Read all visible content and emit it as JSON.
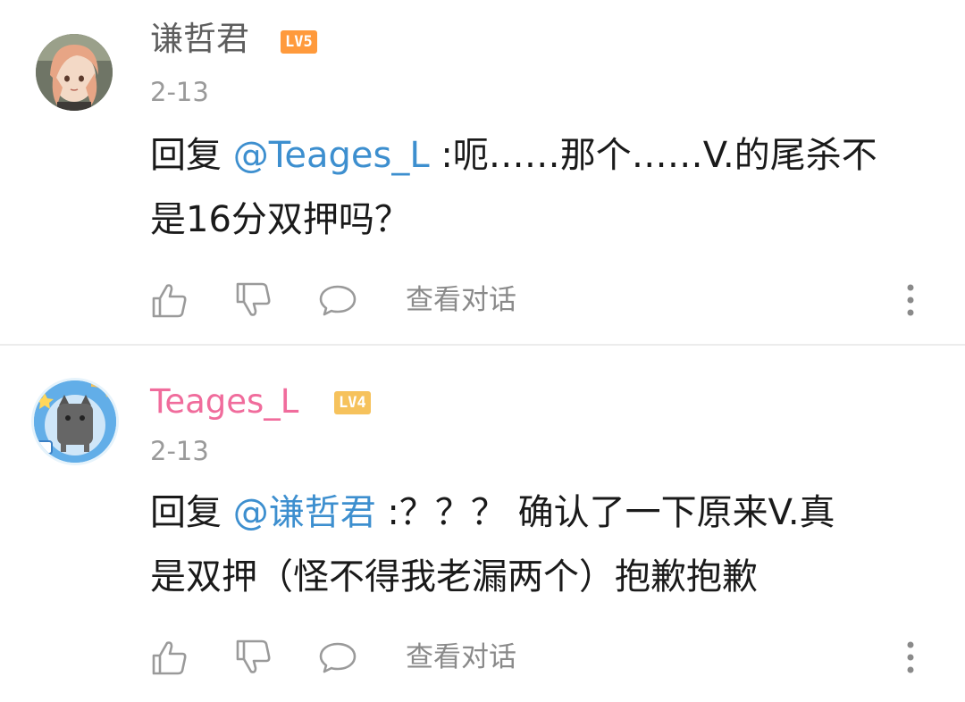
{
  "comments": [
    {
      "username": "谦哲君",
      "level": "LV5",
      "date": "2-13",
      "reply_prefix": "回复 ",
      "mention": "@Teages_L",
      "text_line1": " :呃……那个……V.的尾杀不",
      "text_line2": "是16分双押吗？",
      "view_conversation": "查看对话",
      "colors": {
        "username": "#5e5e5e",
        "level_bg": "#ff9a3c"
      },
      "avatar_icon": "anime-character-avatar"
    },
    {
      "username": "Teages_L",
      "level": "LV4",
      "date": "2-13",
      "reply_prefix": "回复 ",
      "mention": "@谦哲君",
      "text_line1": " :？？？ 确认了一下原来V.真",
      "text_line2": "是双押（怪不得我老漏两个）抱歉抱歉",
      "view_conversation": "查看对话",
      "colors": {
        "username": "#f06c9c",
        "level_bg": "#f6c25c"
      },
      "avatar_icon": "cat-avatar-with-up-badge"
    }
  ],
  "colors": {
    "mention": "#3d8fcf",
    "text": "#1a1a1a",
    "muted": "#9a9a9a",
    "divider": "#ececec"
  },
  "icons": [
    "thumbs-up-icon",
    "thumbs-down-icon",
    "reply-bubble-icon",
    "more-vertical-icon"
  ]
}
